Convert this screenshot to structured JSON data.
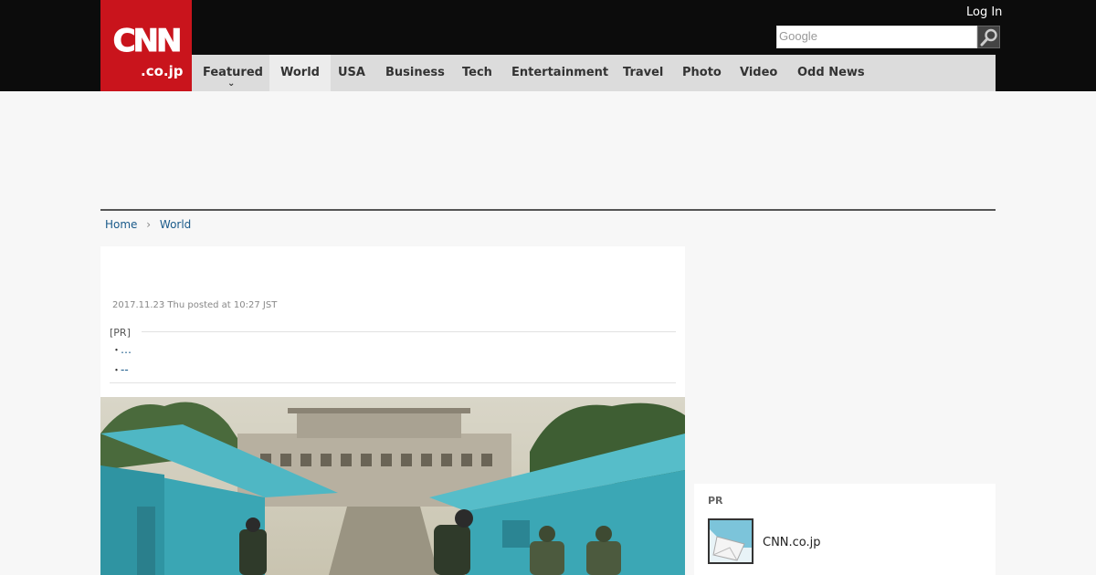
{
  "header": {
    "logo_main": "CNN",
    "logo_sub": ".co.jp",
    "login_label": "Log In",
    "search": {
      "placeholder": "Google",
      "button_icon": "search-icon"
    },
    "brand_color": "#c9141c"
  },
  "nav": {
    "items": [
      {
        "label": "Featured",
        "has_dropdown": true
      },
      {
        "label": "World",
        "active": true
      },
      {
        "label": "USA"
      },
      {
        "label": "Business"
      },
      {
        "label": "Tech"
      },
      {
        "label": "Entertainment"
      },
      {
        "label": "Travel"
      },
      {
        "label": "Photo"
      },
      {
        "label": "Video"
      },
      {
        "label": "Odd News"
      }
    ]
  },
  "breadcrumb": {
    "home": "Home",
    "current": "World"
  },
  "article": {
    "posted": "2017.11.23 Thu posted at 10:27 JST",
    "pr_label": "[PR]",
    "pr_items": [
      {
        "bullet": "・",
        "text": "…"
      },
      {
        "bullet": "・",
        "text": "--"
      }
    ]
  },
  "sidebar": {
    "pr_label": "PR",
    "pr_item_title": "CNN.co.jp"
  }
}
